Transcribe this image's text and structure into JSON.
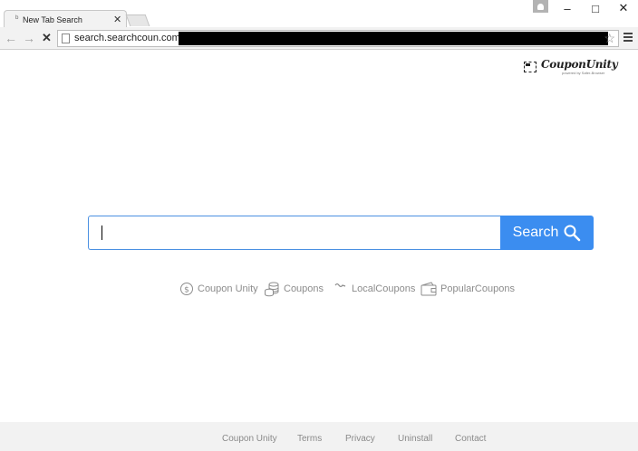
{
  "browser": {
    "tab_title": "New Tab Search",
    "tab_favicon": "ᵇ",
    "tab_close": "✕",
    "url": "search.searchcoun.com",
    "window_controls": {
      "minimize": "–",
      "maximize": "□",
      "close": "✕"
    },
    "nav": {
      "back": "←",
      "forward": "→",
      "stop": "✕"
    },
    "star": "☆"
  },
  "logo": {
    "name": "CouponUnity",
    "tagline": "powered by Safer-Browser"
  },
  "search": {
    "placeholder": "",
    "value": "",
    "button_label": "Search"
  },
  "quicklinks": [
    {
      "label": "Coupon Unity",
      "icon": "dollar-coin-icon"
    },
    {
      "label": "Coupons",
      "icon": "coin-stack-icon"
    },
    {
      "label": "LocalCoupons",
      "icon": "local-coupons-icon"
    },
    {
      "label": "PopularCoupons",
      "icon": "wallet-icon"
    }
  ],
  "footer": {
    "links": [
      "Coupon Unity",
      "Terms",
      "Privacy",
      "Uninstall",
      "Contact"
    ]
  },
  "colors": {
    "accent": "#3b8df0",
    "input_border": "#4a90e2",
    "footer_bg": "#f2f2f2",
    "link_gray": "#8c8c8c"
  }
}
